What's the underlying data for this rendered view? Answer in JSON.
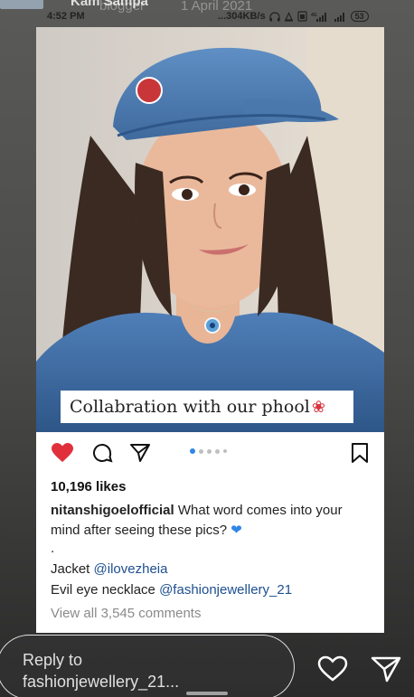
{
  "status_bar": {
    "time": "4:52 PM",
    "network_speed": "...304KB/s",
    "battery": "53"
  },
  "story_header": {
    "username": "Kam Sampa",
    "overlay_name": "blogger",
    "date": "1 April 2021"
  },
  "post": {
    "image_caption": "Collabration with our phool",
    "likes": "10,196 likes",
    "caption_user": "nitanshigoelofficial",
    "caption_text": "What word comes into your mind after seeing these pics?",
    "dot_line": ".",
    "jacket_label": "Jacket",
    "jacket_mention": "@ilovezheia",
    "necklace_label": "Evil eye necklace",
    "necklace_mention": "@fashionjewellery_21",
    "view_comments": "View all 3,545 comments",
    "carousel": {
      "total": 5,
      "active_index": 0
    }
  },
  "reply": {
    "placeholder_line1": "Reply to",
    "placeholder_line2": "fashionjewellery_21..."
  },
  "colors": {
    "like_active": "#e0303c",
    "carousel_active": "#2f86e6",
    "mention": "#1d4f8f"
  },
  "icons": [
    "heart-icon",
    "comment-icon",
    "send-icon",
    "bookmark-icon",
    "story-heart-icon",
    "story-send-icon"
  ]
}
